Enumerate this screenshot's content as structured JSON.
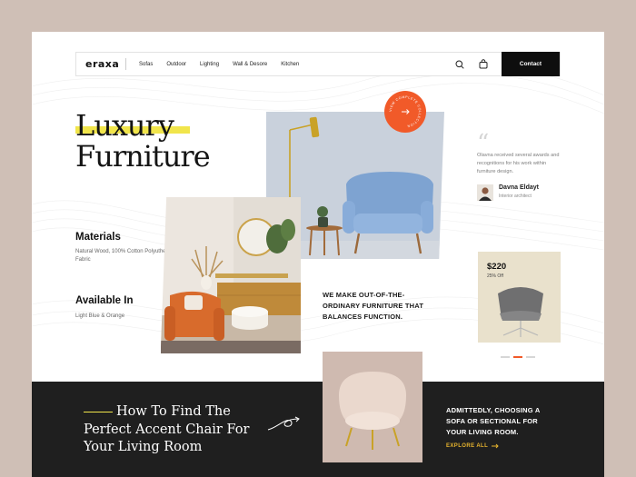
{
  "nav": {
    "logo": "eraxa",
    "menu": [
      "Sofas",
      "Outdoor",
      "Lighting",
      "Wall & Desore",
      "Kitchen"
    ],
    "contact_label": "Contact",
    "icons": [
      "search-icon",
      "bag-icon"
    ]
  },
  "hero": {
    "title_line1": "Luxury",
    "title_line2": "Furniture",
    "materials_title": "Materials",
    "materials_text": "Natural Wood, 100% Cotton Polyutherine Fabric",
    "available_title": "Available In",
    "available_text": "Light Blue & Orange",
    "badge_text": "VIEW COMPLETE COLLECTION",
    "statement": "WE MAKE OUT-OF-THE-ORDINARY FURNITURE THAT BALANCES FUNCTION."
  },
  "testimonial": {
    "quote": "Olavna received several awards and recognitions for his work within furniture design.",
    "name": "Davna Eldayt",
    "role": "Interior architect"
  },
  "product": {
    "price": "$220",
    "discount": "25% Off"
  },
  "carousel": {
    "count": 3,
    "active_index": 1
  },
  "article": {
    "title": "How To Find The Perfect Accent Chair For Your Living Room",
    "text": "ADMITTEDLY, CHOOSING A SOFA OR SECTIONAL FOR YOUR LIVING ROOM.",
    "cta": "EXPLORE ALL"
  },
  "colors": {
    "background": "#cfbfb6",
    "accent_orange": "#f15a29",
    "highlight_yellow": "#f1e54b",
    "dark": "#1f1f1f",
    "gold": "#e8b52e"
  }
}
